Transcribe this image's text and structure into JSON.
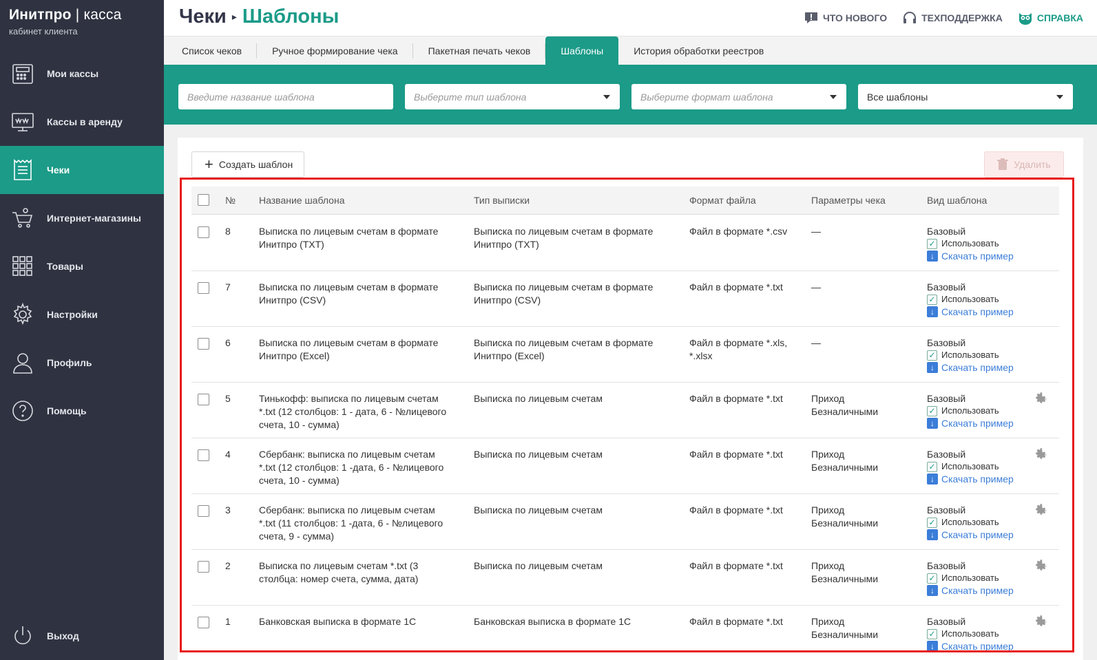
{
  "brand": {
    "title": "Инитпро",
    "title_sep": " | ",
    "title_light": "касса",
    "subtitle": "кабинет клиента"
  },
  "sidebar": {
    "items": [
      {
        "label": "Мои кассы",
        "icon": "cash-register-icon"
      },
      {
        "label": "Кассы в аренду",
        "icon": "monitor-www-icon"
      },
      {
        "label": "Чеки",
        "icon": "receipt-icon",
        "active": true
      },
      {
        "label": "Интернет-магазины",
        "icon": "cart-icon"
      },
      {
        "label": "Товары",
        "icon": "grid-icon"
      },
      {
        "label": "Настройки",
        "icon": "gear-icon"
      },
      {
        "label": "Профиль",
        "icon": "user-icon"
      },
      {
        "label": "Помощь",
        "icon": "question-icon"
      }
    ],
    "logout": "Выход"
  },
  "header": {
    "crumb_root": "Чеки",
    "crumb_sep": "▸",
    "crumb_current": "Шаблоны",
    "links": {
      "news": "Что нового",
      "support": "Техподдержка",
      "help": "Справка"
    }
  },
  "tabs": [
    "Список чеков",
    "Ручное формирование чека",
    "Пакетная печать чеков",
    "Шаблоны",
    "История обработки реестров"
  ],
  "filters": {
    "name_placeholder": "Введите название шаблона",
    "type_placeholder": "Выберите тип шаблона",
    "format_placeholder": "Выберите формат шаблона",
    "scope_value": "Все шаблоны"
  },
  "toolbar": {
    "create_label": "Создать шаблон",
    "delete_label": "Удалить"
  },
  "table": {
    "headers": {
      "num": "№",
      "name": "Название шаблона",
      "type": "Тип выписки",
      "format": "Формат файла",
      "params": "Параметры чека",
      "kind": "Вид шаблона"
    },
    "kind_label": "Базовый",
    "use_label": "Использовать",
    "download_label": "Скачать пример",
    "rows": [
      {
        "num": "8",
        "name_1": "Выписка по лицевым счетам в формате",
        "name_2": "Инитпро (TXT)",
        "name_3": "",
        "type_1": "Выписка по лицевым счетам в формате",
        "type_2": "Инитпро (TXT)",
        "format_1": "Файл в формате *.csv",
        "format_2": "",
        "params_1": "—",
        "params_2": "",
        "gear": false
      },
      {
        "num": "7",
        "name_1": "Выписка по лицевым счетам в формате",
        "name_2": "Инитпро (CSV)",
        "name_3": "",
        "type_1": "Выписка по лицевым счетам в формате",
        "type_2": "Инитпро (CSV)",
        "format_1": "Файл в формате *.txt",
        "format_2": "",
        "params_1": "—",
        "params_2": "",
        "gear": false
      },
      {
        "num": "6",
        "name_1": "Выписка по лицевым счетам в формате",
        "name_2": "Инитпро (Excel)",
        "name_3": "",
        "type_1": "Выписка по лицевым счетам в формате",
        "type_2": "Инитпро (Excel)",
        "format_1": "Файл в формате *.xls,",
        "format_2": "*.xlsx",
        "params_1": "—",
        "params_2": "",
        "gear": false
      },
      {
        "num": "5",
        "name_1": "Тинькофф: выписка по лицевым счетам",
        "name_2": "*.txt (12 столбцов: 1 - дата, 6 - №лицевого",
        "name_3": "счета, 10 - сумма)",
        "type_1": "Выписка по лицевым счетам",
        "type_2": "",
        "format_1": "Файл в формате *.txt",
        "format_2": "",
        "params_1": "Приход",
        "params_2": "Безналичными",
        "gear": true
      },
      {
        "num": "4",
        "name_1": "Сбербанк: выписка по лицевым счетам",
        "name_2": "*.txt (12 столбцов: 1 -дата, 6 - №лицевого",
        "name_3": "счета, 10 - сумма)",
        "type_1": "Выписка по лицевым счетам",
        "type_2": "",
        "format_1": "Файл в формате *.txt",
        "format_2": "",
        "params_1": "Приход",
        "params_2": "Безналичными",
        "gear": true
      },
      {
        "num": "3",
        "name_1": "Сбербанк: выписка по лицевым счетам",
        "name_2": "*.txt (11 столбцов: 1 -дата, 6 - №лицевого",
        "name_3": "счета, 9 - сумма)",
        "type_1": "Выписка по лицевым счетам",
        "type_2": "",
        "format_1": "Файл в формате *.txt",
        "format_2": "",
        "params_1": "Приход",
        "params_2": "Безналичными",
        "gear": true
      },
      {
        "num": "2",
        "name_1": "Выписка по лицевым счетам *.txt (3",
        "name_2": "столбца: номер счета, сумма, дата)",
        "name_3": "",
        "type_1": "Выписка по лицевым счетам",
        "type_2": "",
        "format_1": "Файл в формате *.txt",
        "format_2": "",
        "params_1": "Приход",
        "params_2": "Безналичными",
        "gear": true
      },
      {
        "num": "1",
        "name_1": "Банковская выписка в формате 1С",
        "name_2": "",
        "name_3": "",
        "type_1": "Банковская выписка в формате 1С",
        "type_2": "",
        "format_1": "Файл в формате *.txt",
        "format_2": "",
        "params_1": "Приход",
        "params_2": "Безналичными",
        "gear": true
      }
    ]
  },
  "colors": {
    "accent": "#1b9b88",
    "sidebar": "#2f3341",
    "link": "#3b7dd8",
    "highlight": "#e81818"
  }
}
